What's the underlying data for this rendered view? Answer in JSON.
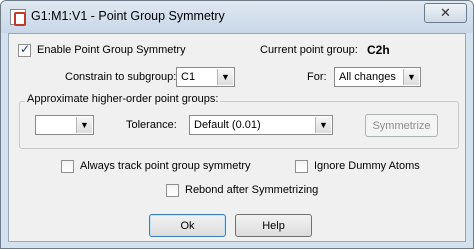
{
  "window": {
    "title": "G1:M1:V1 - Point Group Symmetry",
    "close_glyph": "✕"
  },
  "main": {
    "enable_label": "Enable Point Group Symmetry",
    "enable_checked": true,
    "current_group_label": "Current point group:",
    "current_group_value": "C2h",
    "constrain_label": "Constrain to subgroup:",
    "constrain_value": "C1",
    "for_label": "For:",
    "for_value": "All changes"
  },
  "approx_group": {
    "title": "Approximate higher-order point groups:",
    "group_value": "",
    "tolerance_label": "Tolerance:",
    "tolerance_value": "Default (0.01)",
    "symmetrize_label": "Symmetrize"
  },
  "options": {
    "always_track_label": "Always track point group symmetry",
    "ignore_dummy_label": "Ignore Dummy Atoms",
    "rebond_label": "Rebond after Symmetrizing"
  },
  "buttons": {
    "ok_label": "Ok",
    "help_label": "Help"
  },
  "icons": {
    "dropdown_arrow": "▼"
  }
}
